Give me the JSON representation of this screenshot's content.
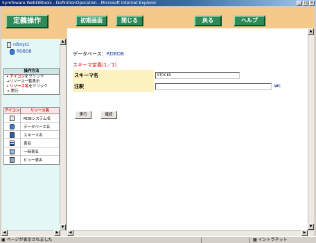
{
  "window": {
    "title": "Symfoware WebDBtools - DefinitionOperation - Microsoft Internet Explorer",
    "controls": [
      "_",
      "□",
      "×"
    ]
  },
  "sidebar": {
    "title": "定義操作",
    "tree": [
      {
        "label": "rdbsys1",
        "icon": "system-icon"
      },
      {
        "label": "RDBDB",
        "icon": "database-icon"
      }
    ],
    "howto": {
      "heading": "操作方法",
      "line1_red": "アイコン",
      "line1_rest": "をクリック",
      "line2": "→リソース一覧表示",
      "line3_red": "リソース名",
      "line3_rest": "をクリック",
      "line4": "→ 実行"
    },
    "legend": {
      "col_icon": "アイコン",
      "col_name": "リソース名",
      "rows": [
        {
          "label": "RDBシステム名",
          "icon": "rdb-system-icon",
          "color": "#e8e8e8"
        },
        {
          "label": "データベース名",
          "icon": "database-icon",
          "color": "#3a7bd5"
        },
        {
          "label": "スキーマ名",
          "icon": "schema-icon",
          "color": "#2a5db0"
        },
        {
          "label": "表名",
          "icon": "table-icon",
          "color": "#1b4f9c"
        },
        {
          "label": "一時表名",
          "icon": "temp-table-icon",
          "color": "#6fa0d8"
        },
        {
          "label": "ビュー表名",
          "icon": "view-table-icon",
          "color": "#8fa8c8"
        }
      ]
    }
  },
  "toolbar": {
    "home_label": "初期画面",
    "close_label": "閉じる",
    "back_label": "戻る",
    "help_label": "ヘルプ"
  },
  "main": {
    "db_prefix": "データベース：",
    "db_name": "RDBDB",
    "section_title": "スキーマ定義(1／1)",
    "schema_label": "スキーマ名",
    "schema_value": "STOCKS",
    "comment_label": "注釈",
    "comment_value": "",
    "wc_tag": "WC",
    "execute_label": "実行",
    "confirm_label": "確認"
  },
  "status": {
    "left": "ページが表示されました",
    "right": "イントラネット"
  }
}
